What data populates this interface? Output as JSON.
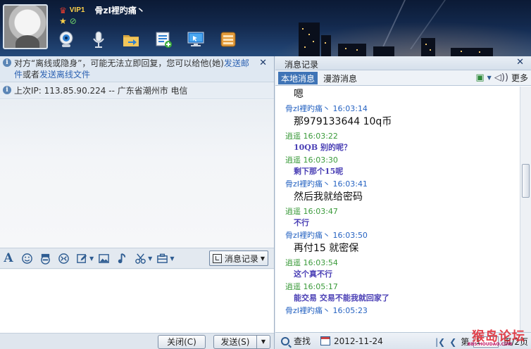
{
  "profile": {
    "vip_label": "VIP1",
    "nickname": "骨zI裡旳痛丶"
  },
  "notice": {
    "text_before": "对方“离线或隐身”，可能无法立即回复，您可以给他(她)",
    "link1": "发送离线",
    "text_mid": "或者",
    "link2": "发送离线文件",
    "line1_end": "发送邮",
    "line2_start": "件"
  },
  "ip_line": "上次IP: 113.85.90.224 -- 广东省潮州市 电信",
  "record_button": "消息记录",
  "bottom_buttons": {
    "close": "关闭(C)",
    "send": "发送(S)"
  },
  "history": {
    "title": "消息记录",
    "tab_local": "本地消息",
    "tab_roam": "漫游消息",
    "more": "更多",
    "search": "查找",
    "date": "2012-11-24",
    "page_prefix": "第",
    "page_value": "1",
    "page_suffix": "页/2页"
  },
  "messages": [
    {
      "type": "body",
      "style": "big",
      "text": "嗯"
    },
    {
      "type": "head",
      "sender": "骨zI裡旳痛丶",
      "time": "16:03:14",
      "color": "blue"
    },
    {
      "type": "body",
      "style": "big",
      "text": "那979133644  10q币"
    },
    {
      "type": "head",
      "sender": "逍遥",
      "time": "16:03:22",
      "color": "green"
    },
    {
      "type": "body",
      "style": "small",
      "text": "10QB   别的呢？"
    },
    {
      "type": "head",
      "sender": "逍遥",
      "time": "16:03:30",
      "color": "green"
    },
    {
      "type": "body",
      "style": "small",
      "text": "剩下那个15呢"
    },
    {
      "type": "head",
      "sender": "骨zI裡旳痛丶",
      "time": "16:03:41",
      "color": "blue"
    },
    {
      "type": "body",
      "style": "big",
      "text": "然后我就给密码"
    },
    {
      "type": "head",
      "sender": "逍遥",
      "time": "16:03:47",
      "color": "green"
    },
    {
      "type": "body",
      "style": "small",
      "text": "不行"
    },
    {
      "type": "head",
      "sender": "骨zI裡旳痛丶",
      "time": "16:03:50",
      "color": "blue"
    },
    {
      "type": "body",
      "style": "big",
      "text": "再付15  就密保"
    },
    {
      "type": "head",
      "sender": "逍遥",
      "time": "16:03:54",
      "color": "green"
    },
    {
      "type": "body",
      "style": "small",
      "text": "这个真不行"
    },
    {
      "type": "head",
      "sender": "逍遥",
      "time": "16:05:17",
      "color": "green"
    },
    {
      "type": "body",
      "style": "small",
      "text": "能交易  交易不能我就回家了"
    },
    {
      "type": "head",
      "sender": "骨zI裡旳痛丶",
      "time": "16:05:23",
      "color": "blue"
    }
  ],
  "watermark": "猴岛论坛",
  "watermark_small": "BBS.HOUDAO.COM",
  "colors": {
    "accent": "#3f74b6",
    "self_name": "#2663c2",
    "peer_name": "#3a9a3a",
    "peer_text": "#4a3fb5"
  }
}
